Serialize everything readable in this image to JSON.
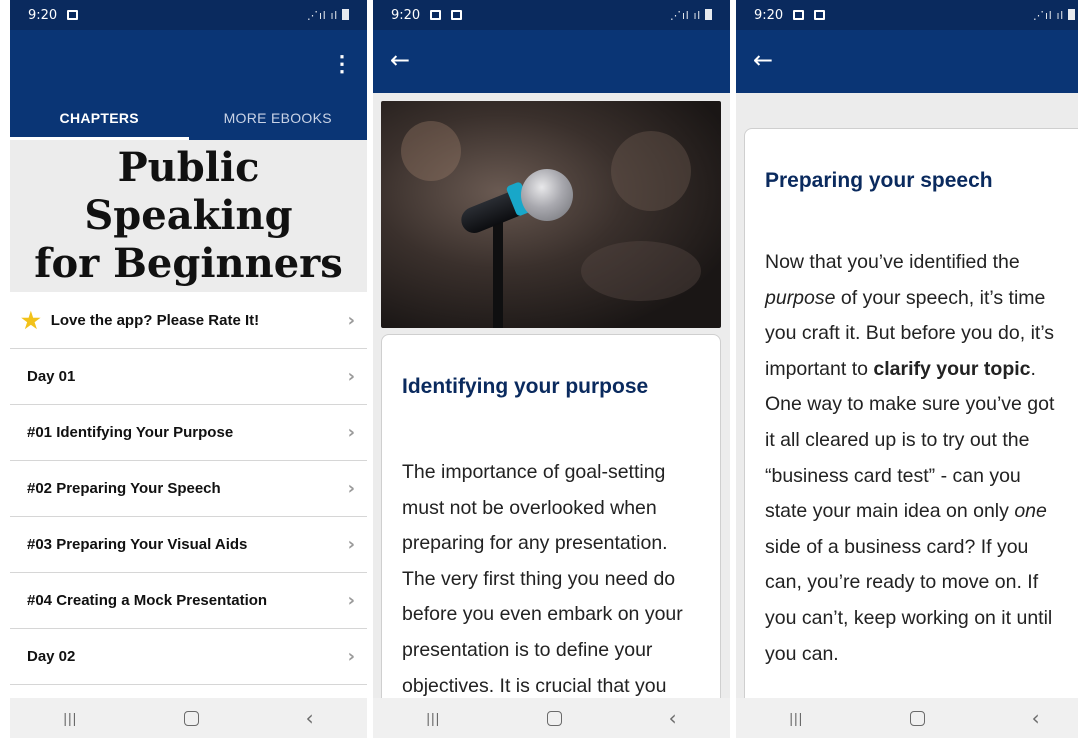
{
  "status": {
    "time": "9:20"
  },
  "screen1": {
    "tabs": [
      {
        "label": "CHAPTERS",
        "active": true
      },
      {
        "label": "MORE EBOOKS",
        "active": false
      }
    ],
    "hero_title_line1": "Public Speaking",
    "hero_title_line2": "for Beginners",
    "list": [
      {
        "label": "Love the app? Please Rate It!",
        "icon": "star-icon"
      },
      {
        "label": "Day 01"
      },
      {
        "label": "#01 Identifying Your Purpose"
      },
      {
        "label": "#02 Preparing Your Speech"
      },
      {
        "label": "#03 Preparing Your Visual Aids"
      },
      {
        "label": "#04 Creating a Mock Presentation"
      },
      {
        "label": "Day 02"
      }
    ]
  },
  "screen2": {
    "title": "Identifying your purpose",
    "body": "The importance of goal-setting must not be overlooked when preparing for any presentation. The very first thing you need do before you even embark on your presentation is to define your objectives. It is crucial that you"
  },
  "screen3": {
    "title": "Preparing your speech",
    "body_1": "Now that you’ve identified the ",
    "body_em_1": "purpose",
    "body_2": " of your speech, it’s time you craft it. But before you do, it’s important to ",
    "body_strong": "clarify your topic",
    "body_3": ". One way to make sure you’ve got it all cleared up is to try out the “business card test” - can you state your main idea on only ",
    "body_em_2": "one",
    "body_4": " side of a business card? If you can, you’re ready to move on. If you can’t, keep working on it until you can."
  },
  "colors": {
    "appbar": "#0a3575",
    "statusbar": "#0a2a5e",
    "heading": "#0a2a5e",
    "star": "#f2c21a"
  }
}
